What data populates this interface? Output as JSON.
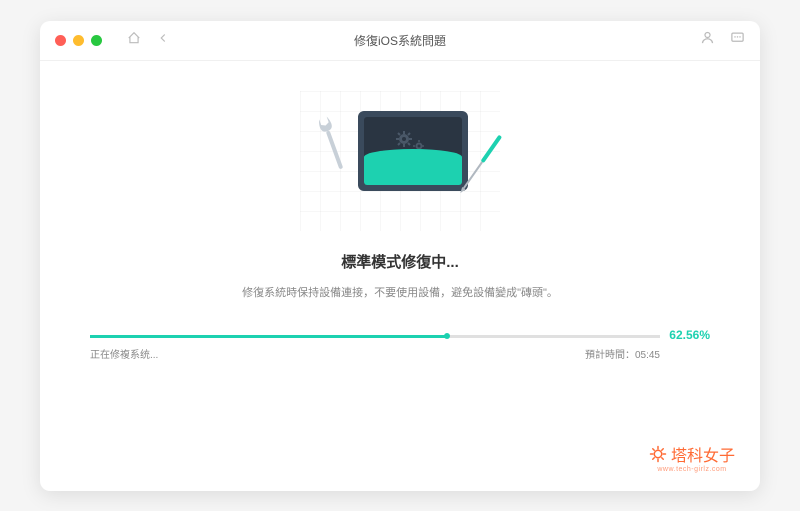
{
  "window": {
    "title": "修復iOS系統問題"
  },
  "main": {
    "heading": "標準模式修復中...",
    "subtext": "修復系統時保持設備連接，不要使用設備，避免設備變成\"磚頭\"。"
  },
  "progress": {
    "percent": 62.56,
    "percent_label": "62.56%",
    "status": "正在修複系统...",
    "eta_label": "預計時間：",
    "eta_value": "05:45"
  },
  "watermark": {
    "brand": "塔科女子",
    "url": "www.tech-girlz.com"
  },
  "colors": {
    "accent": "#1dd1b0",
    "brand": "#ff6b35"
  }
}
